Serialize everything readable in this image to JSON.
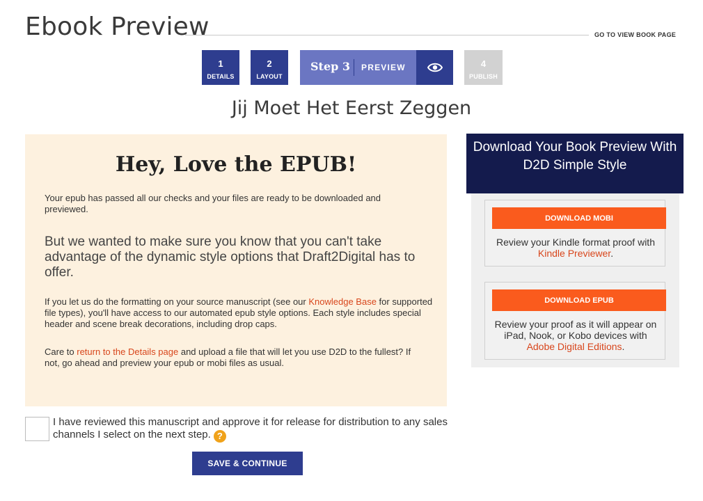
{
  "header": {
    "title": "Ebook Preview",
    "view_link": "GO TO VIEW BOOK PAGE"
  },
  "steps": {
    "step1": {
      "number": "1",
      "label": "DETAILS"
    },
    "step2": {
      "number": "2",
      "label": "LAYOUT"
    },
    "step3": {
      "title": "Step 3",
      "label": "PREVIEW",
      "icon": "eye-icon"
    },
    "step4": {
      "number": "4",
      "label": "PUBLISH"
    }
  },
  "book_title": "Jij Moet Het Eerst Zeggen",
  "notice": {
    "heading": "Hey, Love the EPUB!",
    "p1": "Your epub has passed all our checks and your files are ready to be downloaded and previewed.",
    "p2": "But we wanted to make sure you know that you can't take advantage of the dynamic style options that Draft2Digital has to offer.",
    "p3_before": "If you let us do the formatting on your source manuscript (see our ",
    "p3_link": "Knowledge Base",
    "p3_after": " for supported file types), you'll have access to our automated epub style options. Each style includes special header and scene break decorations, including drop caps.",
    "p4_before": "Care to ",
    "p4_link": "return to the Details page",
    "p4_after": " and upload a file that will let you use D2D to the fullest? If not, go ahead and preview your epub or mobi files as usual."
  },
  "approve": {
    "text": "I have reviewed this manuscript and approve it for release for distribution to any sales channels I select on the next step.",
    "help_icon": "?"
  },
  "save_button": "SAVE & CONTINUE",
  "download": {
    "header": "Download Your Book Preview With D2D Simple Style",
    "mobi": {
      "button": "DOWNLOAD MOBI",
      "text_before": "Review your Kindle format proof with ",
      "link": "Kindle Previewer",
      "text_after": "."
    },
    "epub": {
      "button": "DOWNLOAD EPUB",
      "text_before": "Review your proof as it will appear on iPad, Nook, or Kobo devices with ",
      "link": "Adobe Digital Editions",
      "text_after": "."
    }
  },
  "colors": {
    "primary": "#2e3d8f",
    "step_active": "#6b76c2",
    "navy": "#141b4d",
    "accent_orange": "#fa5b1d",
    "link": "#d8461c",
    "notice_bg": "#fdf1df"
  }
}
